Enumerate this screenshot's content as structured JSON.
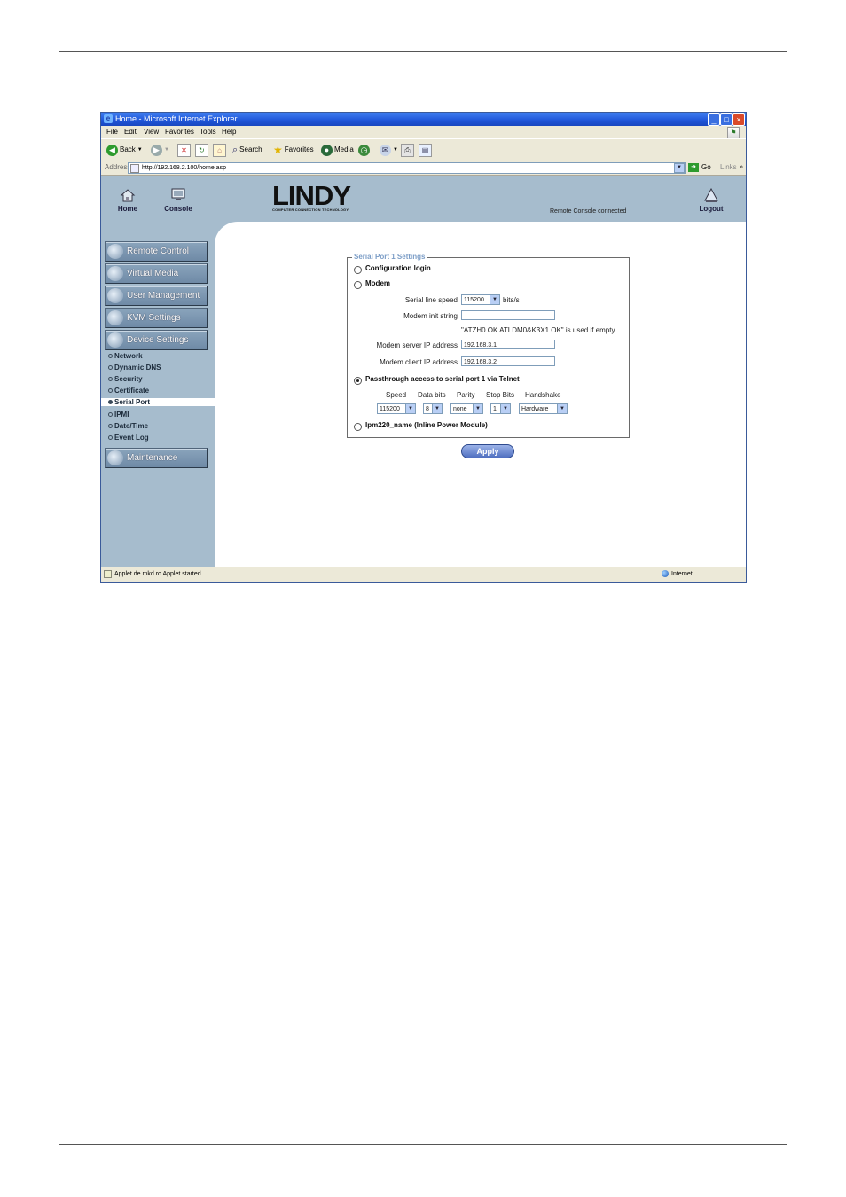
{
  "window": {
    "title": "Home - Microsoft Internet Explorer"
  },
  "menu": [
    "File",
    "Edit",
    "View",
    "Favorites",
    "Tools",
    "Help"
  ],
  "toolbar": {
    "back": "Back",
    "search": "Search",
    "favorites": "Favorites",
    "media": "Media"
  },
  "address": {
    "label": "Address",
    "url": "http://192.168.2.100/home.asp",
    "go": "Go",
    "links": "Links"
  },
  "header": {
    "home": "Home",
    "console": "Console",
    "logo": "LINDY",
    "logo_sub": "COMPUTER CONNECTION TECHNOLOGY",
    "status": "Remote Console connected",
    "logout": "Logout"
  },
  "sidebar": {
    "buttons": [
      "Remote Control",
      "Virtual Media",
      "User Management",
      "KVM Settings",
      "Device Settings"
    ],
    "sub_items": [
      "Network",
      "Dynamic DNS",
      "Security",
      "Certificate",
      "Serial Port",
      "IPMI",
      "Date/Time",
      "Event Log"
    ],
    "active_sub": "Serial Port",
    "maintenance": "Maintenance"
  },
  "form": {
    "legend": "Serial Port 1 Settings",
    "opt_config_login": "Configuration login",
    "opt_modem": "Modem",
    "serial_line_speed_label": "Serial line speed",
    "serial_line_speed_value": "115200",
    "bits_unit": "bits/s",
    "modem_init_label": "Modem init string",
    "modem_init_value": "",
    "modem_note": "\"ATZH0 OK ATLDM0&K3X1 OK\" is used if empty.",
    "modem_server_label": "Modem server IP address",
    "modem_server_value": "192.168.3.1",
    "modem_client_label": "Modem client IP address",
    "modem_client_value": "192.168.3.2",
    "opt_passthrough": "Passthrough access to serial port 1 via Telnet",
    "columns": [
      "Speed",
      "Data bits",
      "Parity",
      "Stop Bits",
      "Handshake"
    ],
    "speed": "115200",
    "data_bits": "8",
    "parity": "none",
    "stop_bits": "1",
    "handshake": "Hardware",
    "opt_ipm": "Ipm220_name (Inline Power Module)",
    "selected_option": "passthrough",
    "apply": "Apply"
  },
  "statusbar": {
    "left": "Applet de.mkd.rc.Applet started",
    "zone": "Internet"
  }
}
